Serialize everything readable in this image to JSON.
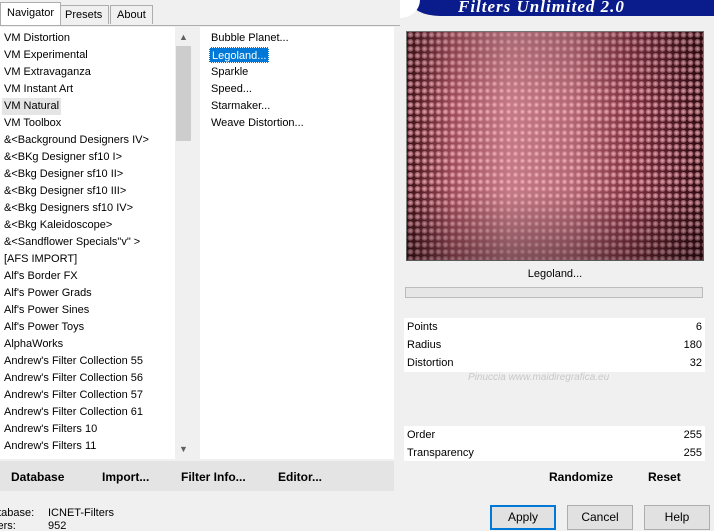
{
  "banner": {
    "title": "Filters Unlimited 2.0"
  },
  "tabs": [
    {
      "label": "Navigator"
    },
    {
      "label": "Presets"
    },
    {
      "label": "About"
    }
  ],
  "categories": [
    "VM Distortion",
    "VM Experimental",
    "VM Extravaganza",
    "VM Instant Art",
    "VM Natural",
    "VM Toolbox",
    "&<Background Designers IV>",
    "&<BKg Designer sf10 I>",
    "&<Bkg Designer sf10 II>",
    "&<Bkg Designer sf10 III>",
    "&<Bkg Designers sf10 IV>",
    "&<Bkg Kaleidoscope>",
    "&<Sandflower Specials\"v\" >",
    "[AFS IMPORT]",
    "Alf's Border FX",
    "Alf's Power Grads",
    "Alf's Power Sines",
    "Alf's Power Toys",
    "AlphaWorks",
    "Andrew's Filter Collection 55",
    "Andrew's Filter Collection 56",
    "Andrew's Filter Collection 57",
    "Andrew's Filter Collection 61",
    "Andrew's Filters 10",
    "Andrew's Filters 11"
  ],
  "selected_category": "VM Natural",
  "filters": [
    "Bubble Planet...",
    "Legoland...",
    "Sparkle",
    "Speed...",
    "Starmaker...",
    "Weave Distortion..."
  ],
  "selected_filter": "Legoland...",
  "left_buttons": {
    "database": "Database",
    "import": "Import...",
    "filter_info": "Filter Info...",
    "editor": "Editor..."
  },
  "preview": {
    "label": "Legoland...",
    "progress": 0
  },
  "params": [
    {
      "label": "Points",
      "value": "6"
    },
    {
      "label": "Radius",
      "value": "180"
    },
    {
      "label": "Distortion",
      "value": "32"
    },
    {
      "label": "Order",
      "value": "255"
    },
    {
      "label": "Transparency",
      "value": "255"
    }
  ],
  "watermark": "Pinuccia www.maidiregrafica.eu",
  "right_buttons": {
    "randomize": "Randomize",
    "reset": "Reset"
  },
  "status": {
    "database_label": "atabase:",
    "database_value": "ICNET-Filters",
    "filters_label": "lters:",
    "filters_value": "952"
  },
  "dialog_buttons": {
    "apply": "Apply",
    "cancel": "Cancel",
    "help": "Help"
  }
}
